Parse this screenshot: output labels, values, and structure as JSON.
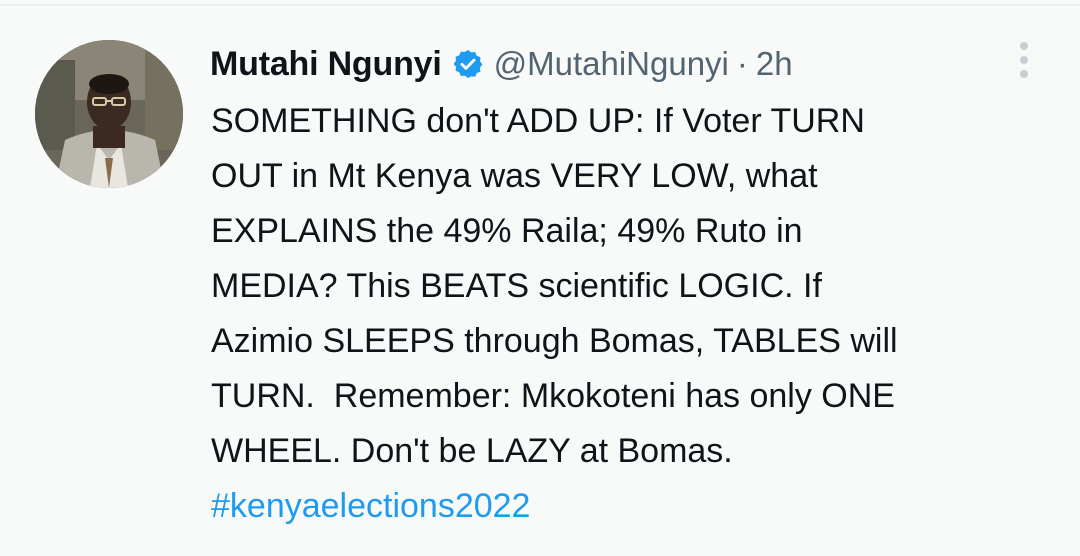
{
  "tweet": {
    "author_name": "Mutahi Ngunyi",
    "handle": "@MutahiNgunyi",
    "separator": "·",
    "time": "2h",
    "body_lines": [
      "SOMETHING don't ADD UP: If Voter TURN",
      "OUT in Mt Kenya was VERY LOW, what",
      "EXPLAINS the 49% Raila; 49% Ruto in",
      "MEDIA? This BEATS scientific LOGIC. If",
      "Azimio SLEEPS through Bomas, TABLES will",
      "TURN.  Remember: Mkokoteni has only ONE",
      "WHEEL. Don't be LAZY at Bomas."
    ],
    "hashtag": "#kenyaelections2022"
  },
  "icons": {
    "avatar": "avatar-photo",
    "verified": "verified-badge-icon",
    "more": "more-options-icon"
  },
  "colors": {
    "text": "#0f1419",
    "muted": "#536471",
    "link": "#1d9bf0",
    "verified": "#1d9bf0",
    "background": "#f8f9f9"
  }
}
